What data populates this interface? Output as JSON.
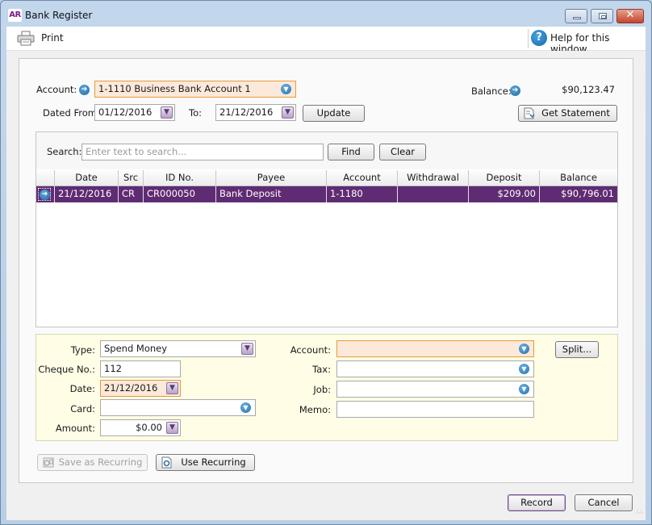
{
  "window": {
    "app_badge": "AR",
    "title": "Bank Register",
    "controls": {
      "minimize": "minimize",
      "maximize": "maximize",
      "close": "✕"
    }
  },
  "toolbar": {
    "print_label": "Print",
    "help_label": "Help for this window",
    "help_glyph": "?"
  },
  "header": {
    "account_label": "Account:",
    "account_value": "1-1110 Business Bank Account 1",
    "dated_from_label": "Dated From:",
    "dated_from_value": "01/12/2016",
    "to_label": "To:",
    "to_value": "21/12/2016",
    "update_button": "Update",
    "balance_label": "Balance:",
    "balance_value": "$90,123.47",
    "get_statement_button": "Get Statement"
  },
  "search": {
    "label": "Search:",
    "placeholder": "Enter text to search...",
    "find_button": "Find",
    "clear_button": "Clear"
  },
  "grid": {
    "columns": [
      "",
      "Date",
      "Src",
      "ID No.",
      "Payee",
      "Account",
      "Withdrawal",
      "Deposit",
      "Balance"
    ],
    "rows": [
      {
        "date": "21/12/2016",
        "src": "CR",
        "id_no": "CR000050",
        "payee": "Bank Deposit",
        "account": "1-1180",
        "withdrawal": "",
        "deposit": "$209.00",
        "balance": "$90,796.01",
        "selected": true
      }
    ]
  },
  "entry": {
    "type_label": "Type:",
    "type_value": "Spend Money",
    "cheque_label": "Cheque No.:",
    "cheque_value": "112",
    "date_label": "Date:",
    "date_value": "21/12/2016",
    "card_label": "Card:",
    "card_value": "",
    "amount_label": "Amount:",
    "amount_value": "$0.00",
    "account_label": "Account:",
    "account_value": "",
    "tax_label": "Tax:",
    "tax_value": "",
    "job_label": "Job:",
    "job_value": "",
    "memo_label": "Memo:",
    "memo_value": "",
    "split_button": "Split..."
  },
  "recurring": {
    "save_as_recurring": "Save as Recurring",
    "use_recurring": "Use Recurring"
  },
  "footer": {
    "record_button": "Record",
    "cancel_button": "Cancel"
  },
  "colors": {
    "selected_row": "#5f2c73",
    "focus_field": "#fde9da",
    "entry_panel": "#fffde6"
  }
}
